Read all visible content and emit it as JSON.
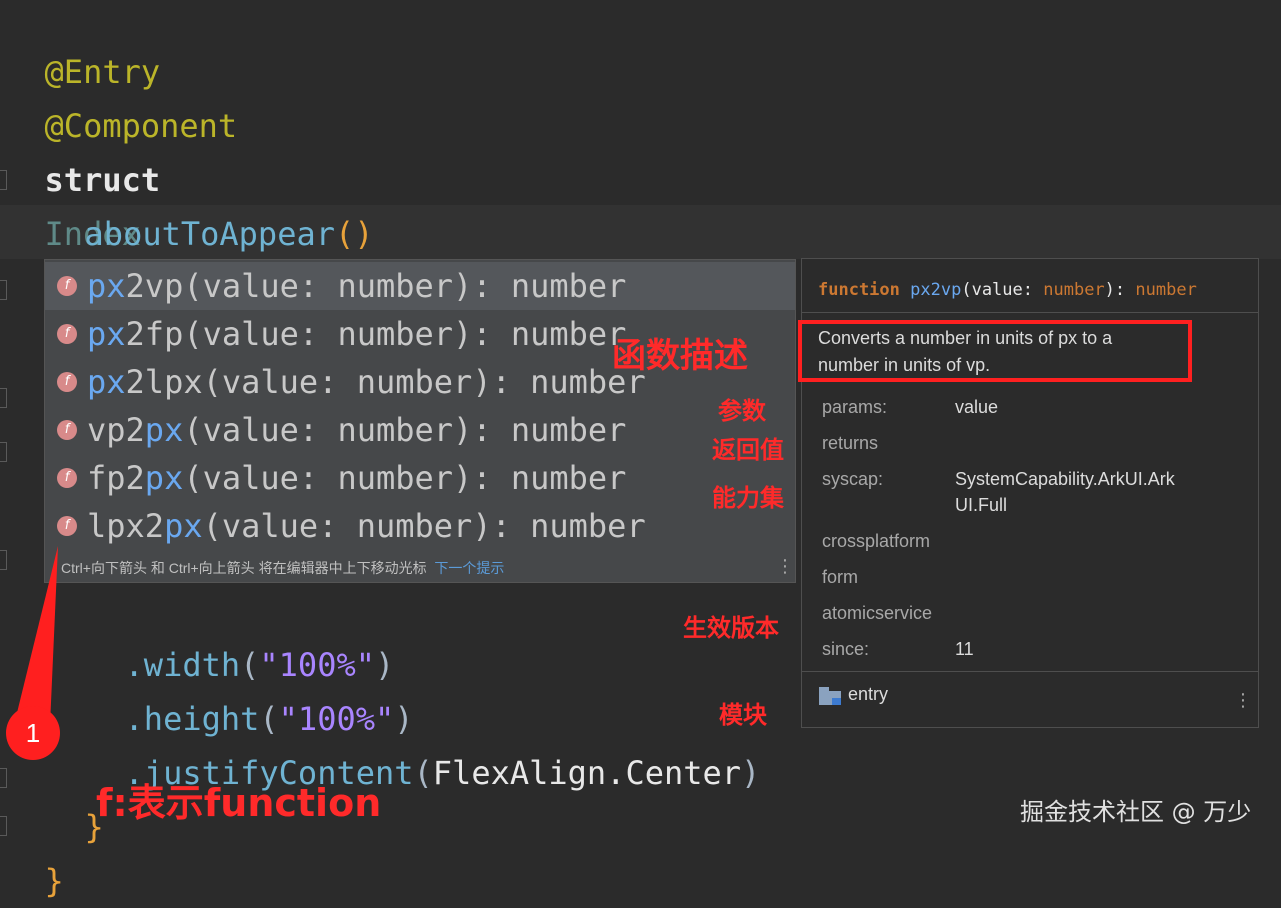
{
  "editor": {
    "lines": {
      "entry": "@Entry",
      "component": "@Component",
      "struct_kw": "struct",
      "struct_name": "Index",
      "open_brace": "{",
      "method": "aboutToAppear",
      "method_parens": "()",
      "typed": "px",
      "width_fn": ".width",
      "width_arg": "\"100%\"",
      "height_fn": ".height",
      "height_arg": "\"100%\"",
      "justify_fn": ".justifyContent",
      "justify_arg": "FlexAlign.Center",
      "close_brace": "}",
      "close_paren": "("
    }
  },
  "completion": {
    "icon_letter": "f",
    "items": [
      {
        "match": "px",
        "rest": "2vp(value: number): number"
      },
      {
        "match": "px",
        "rest": "2fp(value: number): number"
      },
      {
        "match": "px",
        "rest": "2lpx(value: number): number"
      },
      {
        "prefix": "vp2",
        "match": "px",
        "rest": "(value: number): number"
      },
      {
        "prefix": "fp2",
        "match": "px",
        "rest": "(value: number): number"
      },
      {
        "prefix": "lpx2",
        "match": "px",
        "rest": "(value: number): number"
      }
    ],
    "footer_text": "Ctrl+向下箭头 和 Ctrl+向上箭头 将在编辑器中上下移动光标",
    "footer_link": "下一个提示"
  },
  "doc": {
    "signature": {
      "kw": "function",
      "name": "px2vp",
      "open": "(",
      "param": "value",
      "colon": ": ",
      "ptype": "number",
      "close": "): ",
      "rtype": "number"
    },
    "description": "Converts a number in units of px to a number in units of vp.",
    "rows": [
      {
        "label": "params:",
        "value": "value"
      },
      {
        "label": "returns",
        "value": ""
      },
      {
        "label": "syscap:",
        "value": "SystemCapability.ArkUI.ArkUI.Full"
      },
      {
        "label": "crossplatform",
        "value": ""
      },
      {
        "label": "form",
        "value": ""
      },
      {
        "label": "atomicservice",
        "value": ""
      },
      {
        "label": "since:",
        "value": "11"
      }
    ],
    "module": "entry"
  },
  "annotations": {
    "func_desc": "函数描述",
    "params": "参数",
    "returns": "返回值",
    "syscap": "能力集",
    "since": "生效版本",
    "module": "模块",
    "f_meaning": "f:表示function",
    "marker": "1"
  },
  "colors": {
    "background": "#2b2b2b",
    "annotation_red": "#ff2020",
    "popup_bg": "#46484a",
    "selected_item": "#54575b",
    "match_highlight": "#6aa8f0"
  },
  "watermark": "掘金技术社区 @ 万少"
}
